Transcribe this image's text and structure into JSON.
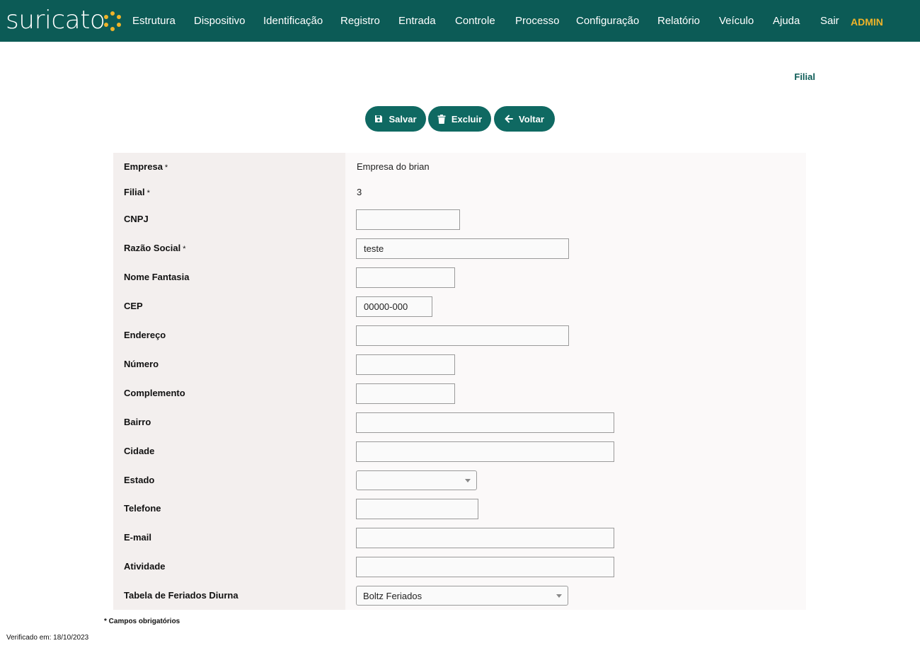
{
  "brand": {
    "name": "suricato",
    "accent": "#f0b429",
    "primary": "#0c5b56"
  },
  "nav": {
    "items": [
      "Estrutura",
      "Dispositivo",
      "Identificação",
      "Registro",
      "Entrada",
      "Controle",
      "Processo",
      "Configuração",
      "Relatório",
      "Veículo",
      "Ajuda",
      "Sair"
    ],
    "user": "ADMIN"
  },
  "page": {
    "title": "Filial"
  },
  "actions": {
    "save": "Salvar",
    "delete": "Excluir",
    "back": "Voltar"
  },
  "form": {
    "required_mark": "*",
    "rows": [
      {
        "label": "Empresa",
        "required": true,
        "value": "Empresa do brian"
      },
      {
        "label": "Filial",
        "required": true,
        "value": "3"
      },
      {
        "label": "CNPJ",
        "value": ""
      },
      {
        "label": "Razão Social",
        "required": true,
        "value": "teste"
      },
      {
        "label": "Nome Fantasia",
        "value": ""
      },
      {
        "label": "CEP",
        "value": "00000-000"
      },
      {
        "label": "Endereço",
        "value": ""
      },
      {
        "label": "Número",
        "value": ""
      },
      {
        "label": "Complemento",
        "value": ""
      },
      {
        "label": "Bairro",
        "value": ""
      },
      {
        "label": "Cidade",
        "value": ""
      },
      {
        "label": "Estado",
        "value": ""
      },
      {
        "label": "Telefone",
        "value": ""
      },
      {
        "label": "E-mail",
        "value": ""
      },
      {
        "label": "Atividade",
        "value": ""
      },
      {
        "label": "Tabela de Feriados Diurna",
        "value": "Boltz Feriados"
      }
    ]
  },
  "footer": {
    "required_note": "* Campos obrigatórios",
    "verified": "Verificado em: 18/10/2023"
  },
  "icons": {
    "save": "floppy-disk-icon",
    "delete": "trash-icon",
    "back": "arrow-left-icon",
    "select": "chevron-down-icon"
  }
}
